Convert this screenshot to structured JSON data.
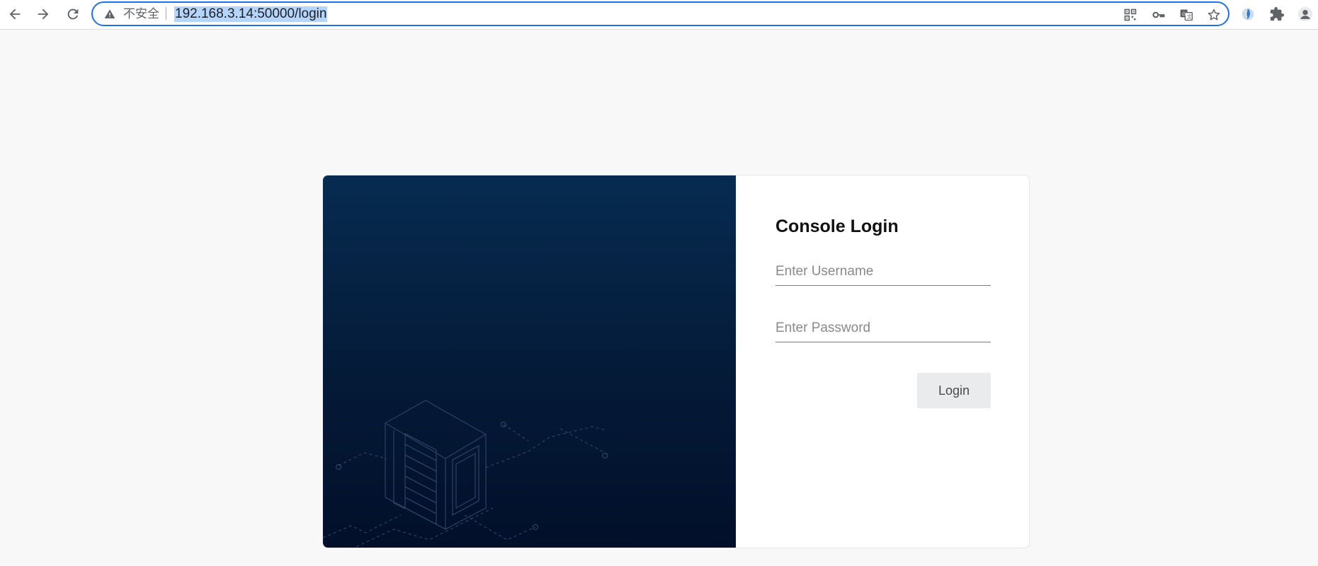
{
  "browser": {
    "security_label": "不安全",
    "url": "192.168.3.14:50000/login",
    "icons": {
      "back": "back-arrow-icon",
      "forward": "forward-arrow-icon",
      "reload": "reload-icon",
      "warning": "warning-triangle-icon",
      "apps": "qr-code-icon",
      "password": "key-icon",
      "translate": "translate-icon",
      "bookmark": "star-icon",
      "extension_app": "extension-logo-icon",
      "extensions": "puzzle-icon",
      "profile": "profile-avatar-icon"
    },
    "accent_color": "#1a73e8"
  },
  "login": {
    "title": "Console Login",
    "username_placeholder": "Enter Username",
    "password_placeholder": "Enter Password",
    "button_label": "Login"
  },
  "colors": {
    "hero_top": "#072b51",
    "hero_bottom": "#020f2a",
    "page_background": "#f8f8f8",
    "button_background": "#e9ebed"
  }
}
